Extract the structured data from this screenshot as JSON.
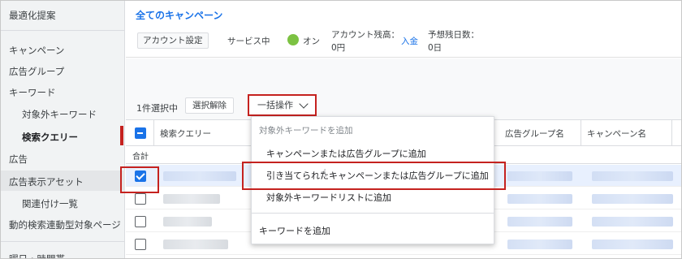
{
  "sidebar": {
    "top": "最適化提案",
    "items": [
      {
        "label": "キャンペーン"
      },
      {
        "label": "広告グループ"
      },
      {
        "label": "キーワード"
      },
      {
        "label": "対象外キーワード"
      },
      {
        "label": "検索クエリー"
      },
      {
        "label": "広告"
      },
      {
        "label": "広告表示アセット"
      },
      {
        "label": "関連付け一覧"
      },
      {
        "label": "動的検索連動型対象ページ"
      },
      {
        "label": "曜日・時間帯"
      }
    ]
  },
  "header": {
    "title": "全てのキャンペーン",
    "account_settings": "アカウント設定",
    "service_label": "サービス中",
    "status": "オン",
    "balance_label": "アカウント残高：",
    "balance_value": "0円",
    "deposit_link": "入金",
    "days_label": "予想残日数：",
    "days_value": "0日"
  },
  "toolbar": {
    "selected_count": "1件選択中",
    "deselect": "選択解除",
    "bulk_action": "一括操作"
  },
  "table": {
    "columns": [
      "検索クエリー",
      "広告グループ名",
      "キャンペーン名"
    ],
    "total_label": "合計"
  },
  "dropdown": {
    "section_header": "対象外キーワードを追加",
    "items": [
      "キャンペーンまたは広告グループに追加",
      "引き当てられたキャンペーンまたは広告グループに追加",
      "対象外キーワードリストに追加"
    ],
    "add_keyword": "キーワードを追加"
  },
  "colors": {
    "accent": "#1a73e8",
    "highlight": "#c5221f",
    "status_on": "#7cc242"
  }
}
